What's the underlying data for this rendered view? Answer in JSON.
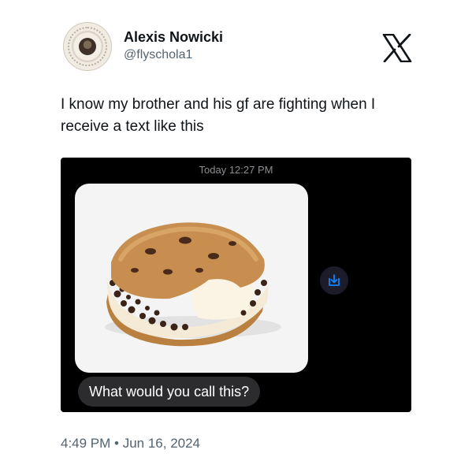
{
  "tweet": {
    "author_name": "Alexis Nowicki",
    "handle": "@flyschola1",
    "text": "I know my brother and his gf are fighting when I receive a text like this",
    "timestamp": "4:49 PM • Jun 16, 2024"
  },
  "message": {
    "time": "Today 12:27 PM",
    "text": "What would you call this?"
  },
  "icons": {
    "brand": "x-logo-icon",
    "save": "download-icon"
  },
  "colors": {
    "accent": "#0a84ff",
    "bubble": "#2c2c2e",
    "secondary_text": "#536471"
  }
}
